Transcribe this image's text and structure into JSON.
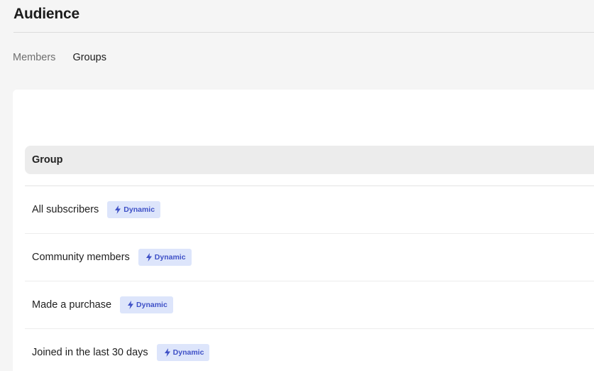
{
  "page": {
    "title": "Audience"
  },
  "tabs": [
    {
      "label": "Members",
      "active": false
    },
    {
      "label": "Groups",
      "active": true
    }
  ],
  "table": {
    "header": "Group",
    "rows": [
      {
        "name": "All subscribers",
        "badge": "Dynamic"
      },
      {
        "name": "Community members",
        "badge": "Dynamic"
      },
      {
        "name": "Made a purchase",
        "badge": "Dynamic"
      },
      {
        "name": "Joined in the last 30 days",
        "badge": "Dynamic"
      }
    ]
  },
  "colors": {
    "badge_bg": "#dde5fb",
    "badge_text": "#3f51c7",
    "background": "#f5f5f5"
  },
  "icons": {
    "badge_icon": "lightning-bolt-icon"
  }
}
